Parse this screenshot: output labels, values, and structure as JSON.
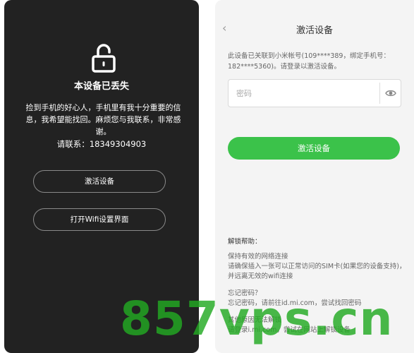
{
  "lost_panel": {
    "title": "本设备已丢失",
    "message": "捡到手机的好心人，手机里有我十分重要的信息，我希望能找回。麻烦您与我联系，非常感谢。",
    "contact": "请联系：18349304903",
    "activate_button": "激活设备",
    "wifi_button": "打开Wifi设置界面",
    "icon": "unlock-icon"
  },
  "activate_panel": {
    "title": "激活设备",
    "description": "此设备已关联到小米帐号(109****389，绑定手机号：182****5360)。请登录以激活设备。",
    "password_placeholder": "密码",
    "activate_button": "激活设备",
    "accent_color": "#3bc24a",
    "help": {
      "title": "解锁帮助：",
      "items": [
        {
          "heading": "保持有效的网络连接",
          "text": "请确保插入一张可以正常访问的SIM卡(如果您的设备支持)，并远离无效的wifi连接"
        },
        {
          "heading": "忘记密码？",
          "text": "忘记密码，请前往id.mi.com，尝试找回密码"
        },
        {
          "heading": "其他原因无法解锁",
          "text": "请登录i.mi.com，尝试在网站上解锁设备"
        }
      ]
    }
  },
  "watermark": "857vps.cn"
}
